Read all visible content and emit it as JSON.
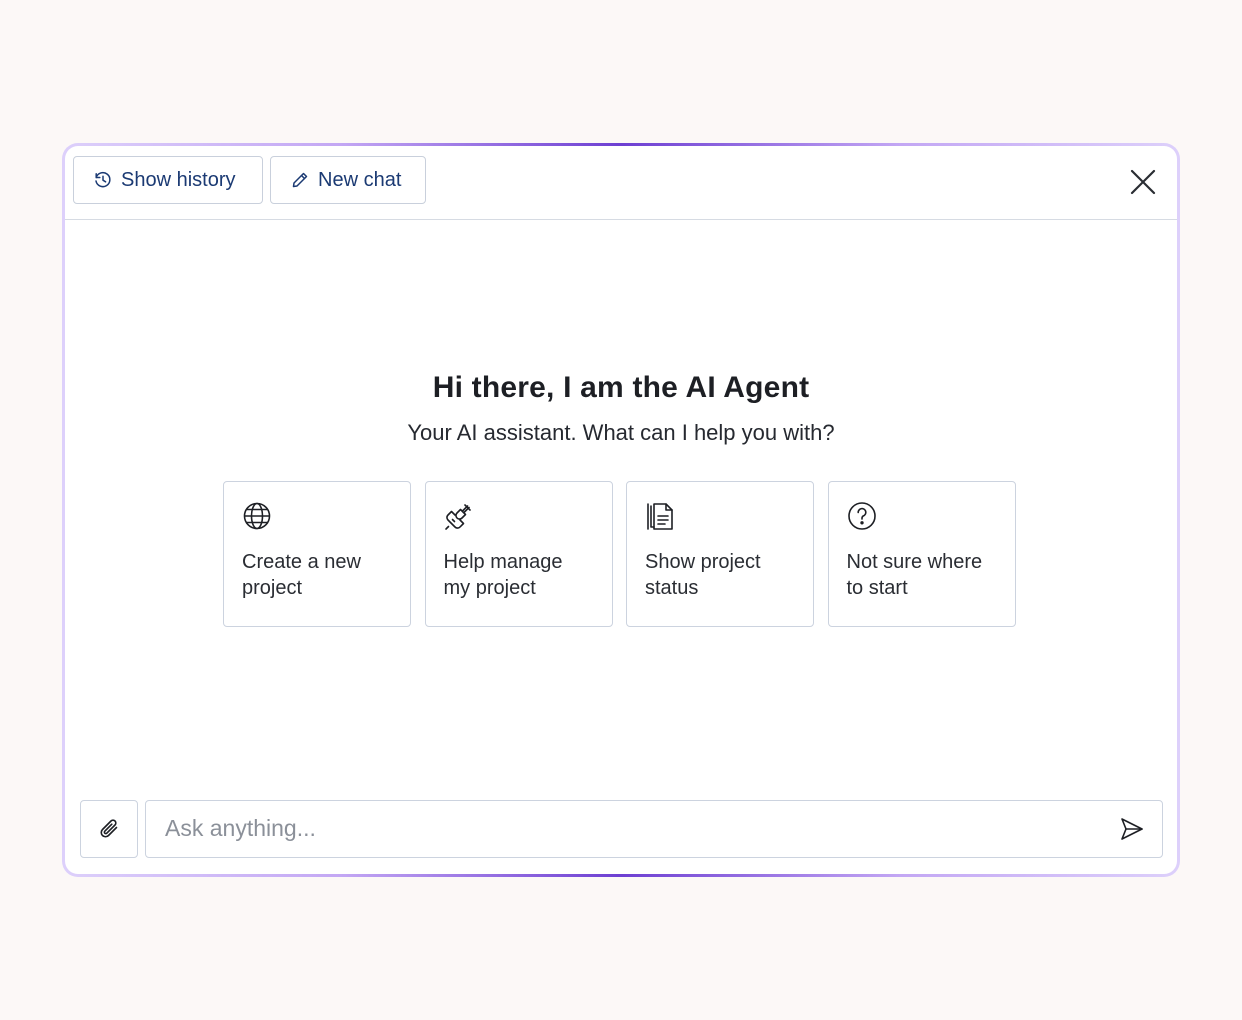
{
  "toolbar": {
    "history_label": "Show history",
    "history_icon": "history-clock-icon",
    "new_chat_label": "New chat",
    "new_chat_icon": "pencil-icon",
    "close_icon": "close-icon"
  },
  "hero": {
    "title": "Hi there, I am the AI Agent",
    "subtitle": "Your AI assistant. What can I help you with?"
  },
  "suggestions": [
    {
      "label": "Create a new project",
      "icon": "globe-icon"
    },
    {
      "label": "Help manage my project",
      "icon": "plug-icon"
    },
    {
      "label": "Show project status",
      "icon": "documents-icon"
    },
    {
      "label": "Not sure where to start",
      "icon": "question-circle-icon"
    }
  ],
  "composer": {
    "placeholder": "Ask anything...",
    "value": "",
    "attach_icon": "paperclip-icon",
    "send_icon": "send-icon"
  },
  "colors": {
    "accent": "#6d3fd2",
    "frame_light": "#ddd0fb",
    "button_text": "#1b3a73",
    "border": "#ccd3df",
    "page_bg": "#fcf8f7"
  }
}
